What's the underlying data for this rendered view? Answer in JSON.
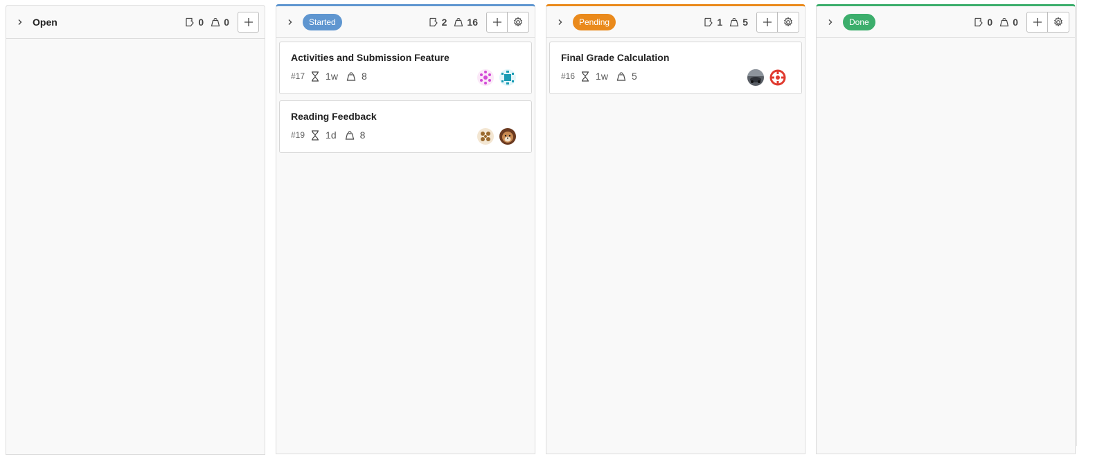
{
  "columns": [
    {
      "title": "Open",
      "styled": false,
      "color": "",
      "issues": "0",
      "weight": "0",
      "has_settings": false,
      "cards": []
    },
    {
      "title": "Started",
      "styled": true,
      "color": "#5f96d0",
      "issues": "2",
      "weight": "16",
      "has_settings": true,
      "cards": [
        {
          "title": "Activities and Submission Feature",
          "id": "#17",
          "time": "1w",
          "weight": "8",
          "avatars": [
            "pink-geometric",
            "teal-geometric"
          ]
        },
        {
          "title": "Reading Feedback",
          "id": "#19",
          "time": "1d",
          "weight": "8",
          "avatars": [
            "brown-geometric",
            "dog-photo"
          ]
        }
      ]
    },
    {
      "title": "Pending",
      "styled": true,
      "color": "#ea8a1c",
      "issues": "1",
      "weight": "5",
      "has_settings": true,
      "cards": [
        {
          "title": "Final Grade Calculation",
          "id": "#16",
          "time": "1w",
          "weight": "5",
          "avatars": [
            "car-photo",
            "red-geometric"
          ]
        }
      ]
    },
    {
      "title": "Done",
      "styled": true,
      "color": "#3cae6c",
      "issues": "0",
      "weight": "0",
      "has_settings": true,
      "cards": []
    }
  ],
  "icons": {
    "chevron": "chevron-right-icon",
    "issues": "issues-icon",
    "weight": "weight-icon",
    "time": "hourglass-icon",
    "add": "plus-icon",
    "settings": "gear-icon"
  }
}
